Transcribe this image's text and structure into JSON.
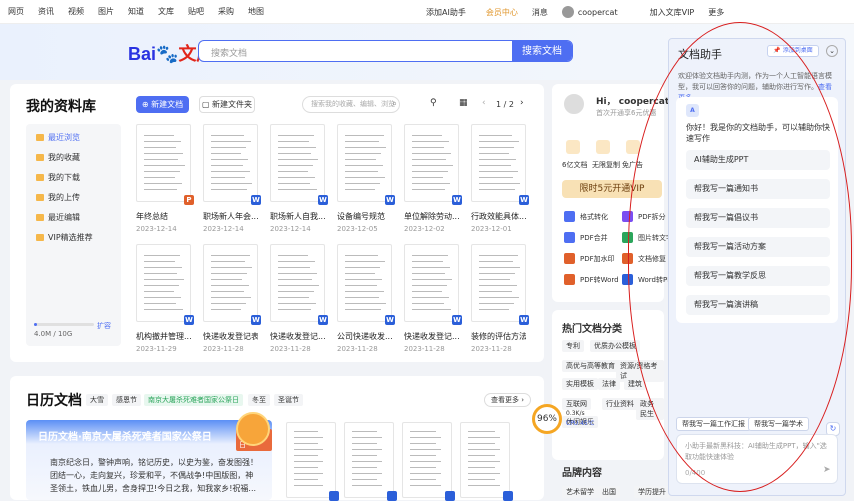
{
  "topbar": {
    "nav": [
      "网页",
      "资讯",
      "视频",
      "图片",
      "知道",
      "文库",
      "贴吧",
      "采购",
      "地图"
    ],
    "ai": "添加AI助手",
    "member": "会员中心",
    "msg": "消息",
    "user": "coopercat",
    "vip": "加入文库VIP",
    "more": "更多"
  },
  "logo": {
    "bai": "Bai",
    "du": "du",
    "lib": "文库"
  },
  "search": {
    "placeholder": "搜索文档",
    "button": "搜索文档"
  },
  "library": {
    "title": "我的资料库",
    "new_doc": "新建文档",
    "new_folder": "新建文件夹",
    "search_ph": "搜索我的收藏、编辑、浏览",
    "page": "1 / 2",
    "side": [
      "最近浏览",
      "我的收藏",
      "我的下载",
      "我的上传",
      "最近编辑",
      "VIP精选推荐"
    ],
    "quota": "4.0M / 10G",
    "expand": "扩容",
    "docs": [
      {
        "name": "年终总结",
        "date": "2023-12-14",
        "type": "P"
      },
      {
        "name": "职场新人年会...",
        "date": "2023-12-14",
        "type": "W"
      },
      {
        "name": "职场新人自我...",
        "date": "2023-12-14",
        "type": "W"
      },
      {
        "name": "设备编号规范",
        "date": "2023-12-05",
        "type": "W"
      },
      {
        "name": "单位解除劳动...",
        "date": "2023-12-02",
        "type": "W"
      },
      {
        "name": "行政效能具体...",
        "date": "2023-12-01",
        "type": "W"
      },
      {
        "name": "机构撤并管理...",
        "date": "2023-11-29",
        "type": "W"
      },
      {
        "name": "快递收发登记表",
        "date": "2023-11-28",
        "type": "W"
      },
      {
        "name": "快递收发登记...",
        "date": "2023-11-28",
        "type": "W"
      },
      {
        "name": "公司快递收发...",
        "date": "2023-11-28",
        "type": "W"
      },
      {
        "name": "快递收发登记...",
        "date": "2023-11-28",
        "type": "W"
      },
      {
        "name": "装修的评估方法",
        "date": "2023-11-28",
        "type": "W"
      }
    ]
  },
  "profile": {
    "hi": "Hi， coopercat",
    "sub": "首次开通享6元优惠",
    "stats": [
      "6亿文档",
      "无限复制",
      "免广告"
    ],
    "vip_btn": "限时5元开通VIP",
    "tools": [
      "格式转化",
      "PDF拆分",
      "PDF合并",
      "图片转文字",
      "PDF加水印",
      "文档修复",
      "PDF转Word",
      "Word转PDF"
    ]
  },
  "hot": {
    "title": "热门文档分类",
    "tags": [
      "专利",
      "优质办公模板",
      "高优与高等教育",
      "资源/资格考试",
      "实用模板",
      "法律",
      "建筑",
      "互联网",
      "行业资料",
      "政务民生",
      "休闲娱乐"
    ],
    "title2": "品牌内容",
    "tags2": [
      "艺术留学",
      "出国",
      "学历提升"
    ]
  },
  "calendar": {
    "title": "日历文档",
    "tags": [
      "大雪",
      "感恩节",
      "南京大屠杀死难者国家公祭日",
      "冬至",
      "圣诞节"
    ],
    "more": "查看更多",
    "banner_title": "日历文档·南京大屠杀死难者国家公祭日",
    "banner_date": "12月13日",
    "banner_text": "南京纪念日，警钟声响，铭记历史，以史为鉴，奋发图强！团结一心，走向复兴，珍爱和平，不偶战争!中国版图，神圣领土，铁血儿男，舍身捍卫!今日之我，知我家乡!祝福..."
  },
  "gauge": {
    "value": "96%",
    "speed": "0.3K/s",
    "cpu": "CPU 45℃"
  },
  "assistant": {
    "title": "文档助手",
    "add": "添加到桌面",
    "intro": "欢迎体验文档助手内测，作为一个人工智能语言模型，我可以回答你的问题，辅助你进行写作。",
    "intro_link": "查看更多",
    "greet": "你好！我是你的文档助手，可以辅助你快速写作",
    "suggestions": [
      "AI辅助生成PPT",
      "帮我写一篇通知书",
      "帮我写一篇倡议书",
      "帮我写一篇活动方案",
      "帮我写一篇教学反思",
      "帮我写一篇演讲稿"
    ],
    "quick": [
      "帮我写一篇工作汇报",
      "帮我写一篇学术"
    ],
    "input_ph": "小助手最新黑科技：AI辅助生成PPT，输入\"选取功能快速体验",
    "count": "0/400"
  },
  "colors": {
    "accent": "#4e6ef2",
    "annotation": "#d81e1e"
  }
}
